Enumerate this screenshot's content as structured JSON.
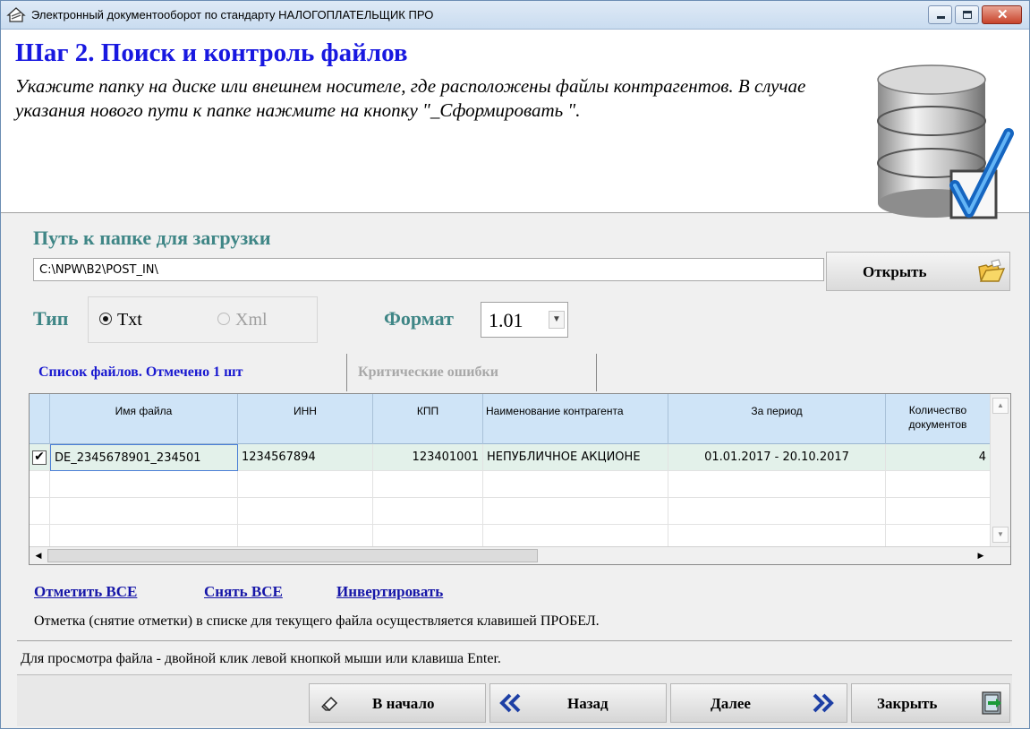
{
  "window": {
    "title": "Электронный документооборот по стандарту НАЛОГОПЛАТЕЛЬЩИК ПРО"
  },
  "header": {
    "title": "Шаг 2. Поиск и контроль файлов",
    "description": "Укажите папку на диске или внешнем носителе, где расположены файлы контрагентов. В случае указания нового пути к папке нажмите на кнопку \"_Сформировать \"."
  },
  "path": {
    "label": "Путь к папке для загрузки",
    "value": "C:\\NPW\\B2\\POST_IN\\",
    "open_label": "Открыть"
  },
  "type": {
    "label": "Тип",
    "options": [
      {
        "label": "Txt",
        "selected": true,
        "enabled": true
      },
      {
        "label": "Xml",
        "selected": false,
        "enabled": false
      }
    ]
  },
  "format": {
    "label": "Формат",
    "value": "1.01"
  },
  "tabs": [
    {
      "label": "Список файлов. Отмечено 1 шт",
      "active": true
    },
    {
      "label": "Критические ошибки",
      "active": false
    }
  ],
  "table": {
    "columns": [
      "Имя файла",
      "ИНН",
      "КПП",
      "Наименование контрагента",
      "За период",
      "Количество документов"
    ],
    "rows": [
      {
        "checked": true,
        "cells": [
          "DE_2345678901_234501",
          "1234567894",
          "123401001",
          "НЕПУБЛИЧНОЕ АКЦИОНЕ",
          "01.01.2017 - 20.10.2017",
          "4"
        ]
      }
    ]
  },
  "actions": {
    "select_all": "Отметить ВСЕ",
    "clear_all": "Снять ВСЕ",
    "invert": "Инвертировать"
  },
  "hints": {
    "space": "Отметка (снятие отметки) в списке для текущего файла осуществляется клавишей ПРОБЕЛ.",
    "view": "Для просмотра файла - двойной клик левой кнопкой мыши или клавиша Enter."
  },
  "nav": {
    "home": "В начало",
    "back": "Назад",
    "next": "Далее",
    "close": "Закрыть"
  },
  "colors": {
    "accent_blue": "#1818e0",
    "label_teal": "#3f8686",
    "header_blue": "#cfe4f7",
    "selected_row": "#e3f1ea"
  }
}
